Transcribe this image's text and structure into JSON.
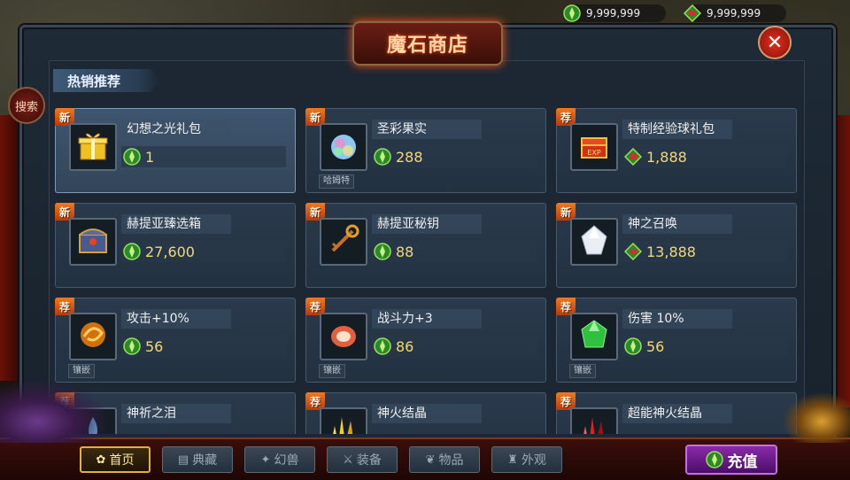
{
  "top": {
    "currency": [
      {
        "value": "9,999,999",
        "icon": "green-gem-icon"
      },
      {
        "value": "9,999,999",
        "icon": "bound-gem-icon"
      }
    ]
  },
  "header": {
    "title": "魔石商店",
    "close_icon": "close-icon",
    "search_label": "搜索",
    "section_tab": "热销推荐"
  },
  "items": [
    {
      "badge": "新",
      "name": "幻想之光礼包",
      "price": "1",
      "currency": "green-gem-icon",
      "tag": "",
      "icon": "gift-box-icon",
      "selected": true
    },
    {
      "badge": "新",
      "name": "圣彩果实",
      "price": "288",
      "currency": "green-gem-icon",
      "tag": "哈姆特",
      "icon": "rainbow-fruit-icon",
      "selected": false
    },
    {
      "badge": "荐",
      "name": "特制经验球礼包",
      "price": "1,888",
      "currency": "bound-gem-icon",
      "tag": "",
      "icon": "exp-chest-icon",
      "selected": false
    },
    {
      "badge": "新",
      "name": "赫提亚臻选箱",
      "price": "27,600",
      "currency": "green-gem-icon",
      "tag": "",
      "icon": "treasure-chest-icon",
      "selected": false
    },
    {
      "badge": "新",
      "name": "赫提亚秘钥",
      "price": "88",
      "currency": "green-gem-icon",
      "tag": "",
      "icon": "key-icon",
      "selected": false
    },
    {
      "badge": "新",
      "name": "神之召唤",
      "price": "13,888",
      "currency": "bound-gem-icon",
      "tag": "",
      "icon": "crystal-icon",
      "selected": false
    },
    {
      "badge": "荐",
      "name": "攻击+10%",
      "price": "56",
      "currency": "green-gem-icon",
      "tag": "镶嵌",
      "icon": "swirl-gem-icon",
      "selected": false
    },
    {
      "badge": "荐",
      "name": "战斗力+3",
      "price": "86",
      "currency": "green-gem-icon",
      "tag": "镶嵌",
      "icon": "red-stone-icon",
      "selected": false
    },
    {
      "badge": "荐",
      "name": "伤害 10%",
      "price": "56",
      "currency": "green-gem-icon",
      "tag": "镶嵌",
      "icon": "green-gem-stone-icon",
      "selected": false
    },
    {
      "badge": "荐",
      "name": "神祈之泪",
      "price": "",
      "currency": "",
      "tag": "",
      "icon": "tear-icon",
      "selected": false
    },
    {
      "badge": "荐",
      "name": "神火结晶",
      "price": "",
      "currency": "",
      "tag": "",
      "icon": "gold-crystal-icon",
      "selected": false
    },
    {
      "badge": "荐",
      "name": "超能神火结晶",
      "price": "",
      "currency": "",
      "tag": "",
      "icon": "red-crystal-icon",
      "selected": false
    }
  ],
  "nav": {
    "tabs": [
      {
        "label": "首页",
        "icon": "home-icon",
        "active": true
      },
      {
        "label": "典藏",
        "icon": "book-icon",
        "active": false
      },
      {
        "label": "幻兽",
        "icon": "beast-icon",
        "active": false
      },
      {
        "label": "装备",
        "icon": "sword-icon",
        "active": false
      },
      {
        "label": "物品",
        "icon": "leaf-icon",
        "active": false
      },
      {
        "label": "外观",
        "icon": "outfit-icon",
        "active": false
      }
    ],
    "recharge_label": "充值"
  },
  "colors": {
    "accent_gold": "#f5d870",
    "badge_orange": "#f07a20",
    "recharge_purple": "#8a2aa8",
    "panel_blue": "#2a3a4c"
  }
}
